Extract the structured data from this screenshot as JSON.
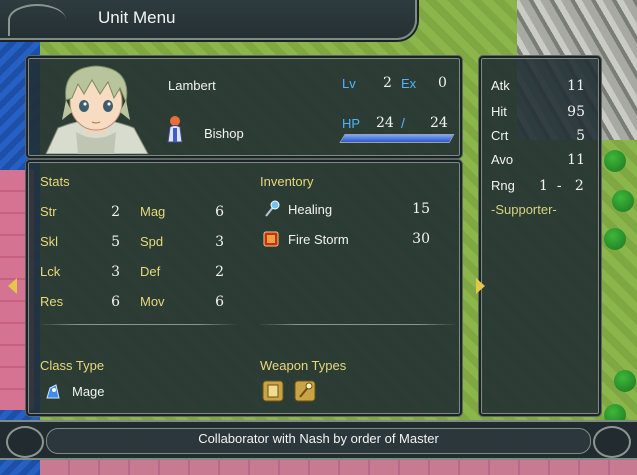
{
  "title_bar": {
    "title": "Unit Menu"
  },
  "unit": {
    "name": "Lambert",
    "class": "Bishop",
    "level_label": "Lv",
    "level": "2",
    "exp_label": "Ex",
    "exp": "0",
    "hp_label": "HP",
    "hp_current": "24",
    "hp_separator": "/",
    "hp_max": "24",
    "hp_fraction": 1.0
  },
  "side_stats": {
    "rows": [
      {
        "label": "Atk",
        "value": "11"
      },
      {
        "label": "Hit",
        "value": "95"
      },
      {
        "label": "Crt",
        "value": "5"
      },
      {
        "label": "Avo",
        "value": "11"
      }
    ],
    "range": {
      "label": "Rng",
      "min": "1",
      "separator": "-",
      "max": "2"
    },
    "skill": "-Supporter-"
  },
  "stats": {
    "heading": "Stats",
    "left": [
      {
        "label": "Str",
        "value": "2"
      },
      {
        "label": "Skl",
        "value": "5"
      },
      {
        "label": "Lck",
        "value": "3"
      },
      {
        "label": "Res",
        "value": "6"
      }
    ],
    "right": [
      {
        "label": "Mag",
        "value": "6"
      },
      {
        "label": "Spd",
        "value": "3"
      },
      {
        "label": "Def",
        "value": "2"
      },
      {
        "label": "Mov",
        "value": "6"
      }
    ]
  },
  "inventory": {
    "heading": "Inventory",
    "items": [
      {
        "name": "Healing",
        "uses": "15",
        "icon": "staff-icon"
      },
      {
        "name": "Fire Storm",
        "uses": "30",
        "icon": "tome-icon"
      }
    ]
  },
  "class_type": {
    "heading": "Class Type",
    "value": "Mage",
    "icon": "mage-icon"
  },
  "weapon_types": {
    "heading": "Weapon Types",
    "icons": [
      "tome-type-icon",
      "staff-type-icon"
    ]
  },
  "description": "Collaborator with Nash by order of Master",
  "colors": {
    "label_yellow": "#e8d879",
    "label_blue": "#4fb3ff",
    "panel_bg": "#223034",
    "arrow": "#e5c54a"
  }
}
